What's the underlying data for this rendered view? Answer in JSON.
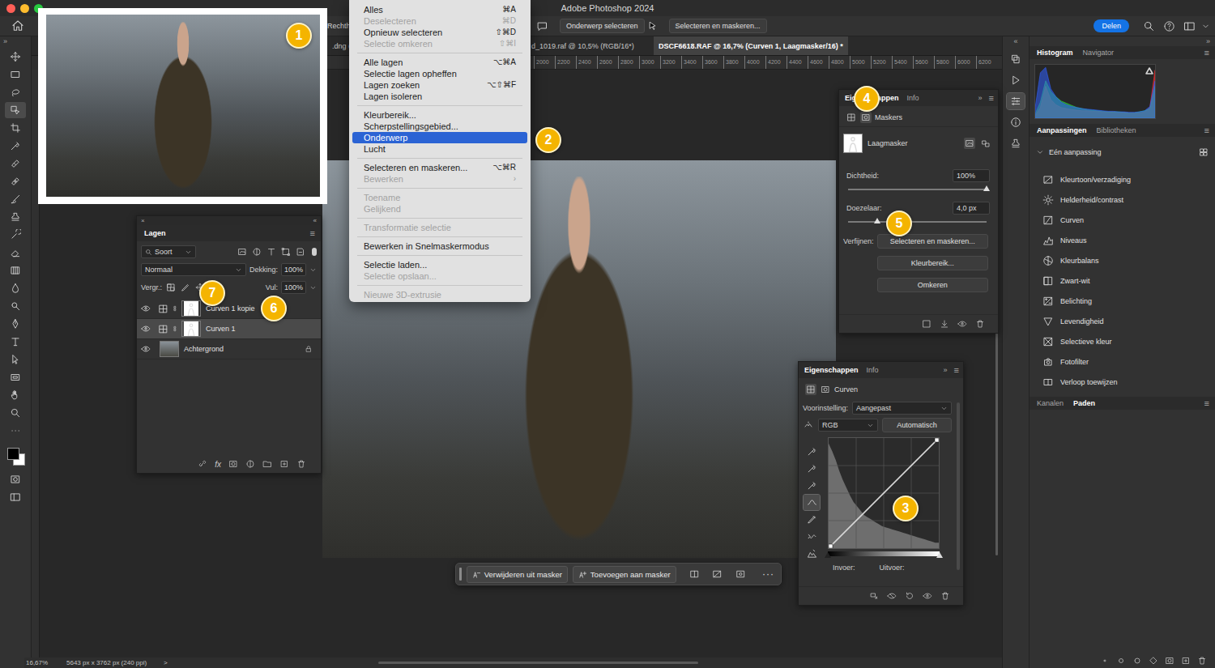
{
  "window": {
    "title": "Adobe Photoshop 2024"
  },
  "options_bar": {
    "tool_label": "Rechth",
    "buttons": [
      "Onderwerp selecteren",
      "Selecteren en maskeren..."
    ],
    "share": "Delen"
  },
  "doc_tabs": [
    {
      "label": ".dng @",
      "selected": false
    },
    {
      "label": "d_1019.raf @ 10,5% (RGB/16*)",
      "selected": false
    },
    {
      "label": "DSCF6618.RAF @ 16,7% (Curven 1, Laagmasker/16) *",
      "selected": true
    }
  ],
  "ruler": [
    "2000",
    "2200",
    "2400",
    "2600",
    "2800",
    "3000",
    "3200",
    "3400",
    "3600",
    "3800",
    "4000",
    "4200",
    "4400",
    "4600",
    "4800",
    "5000",
    "5200",
    "5400",
    "5600",
    "5800",
    "6000",
    "6200"
  ],
  "toolbar": {
    "expand": "»",
    "tools": [
      {
        "selected": false
      },
      {
        "selected": false
      },
      {
        "selected": false
      },
      {
        "selected": true
      },
      {
        "selected": false
      },
      {
        "selected": false
      },
      {
        "selected": false
      },
      {
        "selected": false
      },
      {
        "selected": false
      },
      {
        "selected": false
      },
      {
        "selected": false
      },
      {
        "selected": false
      },
      {
        "selected": false
      },
      {
        "selected": false
      },
      {
        "selected": false
      },
      {
        "selected": false
      },
      {
        "selected": false
      },
      {
        "selected": false
      },
      {
        "selected": false
      },
      {
        "selected": false
      },
      {
        "selected": false
      },
      {
        "selected": false
      }
    ]
  },
  "select_menu": [
    {
      "kind": "item",
      "label": "Alles",
      "shortcut": "⌘A",
      "disabled": false,
      "selected": false
    },
    {
      "kind": "item",
      "label": "Deselecteren",
      "shortcut": "⌘D",
      "disabled": true,
      "selected": false
    },
    {
      "kind": "item",
      "label": "Opnieuw selecteren",
      "shortcut": "⇧⌘D",
      "disabled": false,
      "selected": false
    },
    {
      "kind": "item",
      "label": "Selectie omkeren",
      "shortcut": "⇧⌘I",
      "disabled": true,
      "selected": false
    },
    {
      "kind": "separator",
      "disabled": false,
      "selected": false
    },
    {
      "kind": "item",
      "label": "Alle lagen",
      "shortcut": "⌥⌘A",
      "disabled": false,
      "selected": false
    },
    {
      "kind": "item",
      "label": "Selectie lagen opheffen",
      "shortcut": "",
      "disabled": false,
      "selected": false
    },
    {
      "kind": "item",
      "label": "Lagen zoeken",
      "shortcut": "⌥⇧⌘F",
      "disabled": false,
      "selected": false
    },
    {
      "kind": "item",
      "label": "Lagen isoleren",
      "shortcut": "",
      "disabled": false,
      "selected": false
    },
    {
      "kind": "separator",
      "disabled": false,
      "selected": false
    },
    {
      "kind": "item",
      "label": "Kleurbereik...",
      "shortcut": "",
      "disabled": false,
      "selected": false
    },
    {
      "kind": "item",
      "label": "Scherpstellingsgebied...",
      "shortcut": "",
      "disabled": false,
      "selected": false
    },
    {
      "kind": "item",
      "label": "Onderwerp",
      "shortcut": "",
      "disabled": false,
      "selected": true
    },
    {
      "kind": "item",
      "label": "Lucht",
      "shortcut": "",
      "disabled": false,
      "selected": false
    },
    {
      "kind": "separator",
      "disabled": false,
      "selected": false
    },
    {
      "kind": "item",
      "label": "Selecteren en maskeren...",
      "shortcut": "⌥⌘R",
      "disabled": false,
      "selected": false
    },
    {
      "kind": "item",
      "label": "Bewerken",
      "shortcut": "›",
      "disabled": true,
      "selected": false
    },
    {
      "kind": "separator",
      "disabled": false,
      "selected": false
    },
    {
      "kind": "item",
      "label": "Toename",
      "shortcut": "",
      "disabled": true,
      "selected": false
    },
    {
      "kind": "item",
      "label": "Gelijkend",
      "shortcut": "",
      "disabled": true,
      "selected": false
    },
    {
      "kind": "separator",
      "disabled": false,
      "selected": false
    },
    {
      "kind": "item",
      "label": "Transformatie selectie",
      "shortcut": "",
      "disabled": true,
      "selected": false
    },
    {
      "kind": "separator",
      "disabled": false,
      "selected": false
    },
    {
      "kind": "item",
      "label": "Bewerken in Snelmaskermodus",
      "shortcut": "",
      "disabled": false,
      "selected": false
    },
    {
      "kind": "separator",
      "disabled": false,
      "selected": false
    },
    {
      "kind": "item",
      "label": "Selectie laden...",
      "shortcut": "",
      "disabled": false,
      "selected": false
    },
    {
      "kind": "item",
      "label": "Selectie opslaan...",
      "shortcut": "",
      "disabled": true,
      "selected": false
    },
    {
      "kind": "separator",
      "disabled": false,
      "selected": false
    },
    {
      "kind": "item",
      "label": "Nieuwe 3D-extrusie",
      "shortcut": "",
      "disabled": true,
      "selected": false
    }
  ],
  "layers_panel": {
    "close": "×",
    "collapse": "«",
    "title": "Lagen",
    "menu": "≡",
    "filter": "Soort",
    "blend_mode": "Normaal",
    "opacity_label": "Dekking:",
    "opacity": "100%",
    "lock_label": "Vergr.:",
    "fill_label": "Vul:",
    "fill": "100%",
    "layers": [
      {
        "name": "Curven 1 kopie",
        "kind": "adjustment",
        "visible": true,
        "selected": false,
        "locked": false
      },
      {
        "name": "Curven 1",
        "kind": "adjustment",
        "visible": true,
        "selected": true,
        "locked": false
      },
      {
        "name": "Achtergrond",
        "kind": "image",
        "visible": true,
        "selected": false,
        "locked": true
      }
    ],
    "footer_fx": "fx"
  },
  "mask_properties": {
    "tabs": [
      {
        "label": "Eigenschappen",
        "selected": true
      },
      {
        "label": "Info",
        "selected": false
      }
    ],
    "expand": "»",
    "menu": "≡",
    "section": "Maskers",
    "mask_name": "Laagmasker",
    "sliders": [
      {
        "label": "Dichtheid:",
        "value": "100%",
        "level": 1
      },
      {
        "label": "Doezelaar:",
        "value": "4,0 px",
        "level": 0.21
      }
    ],
    "refine_label": "Verfijnen:",
    "buttons": [
      "Selecteren en maskeren...",
      "Kleurbereik...",
      "Omkeren"
    ]
  },
  "curves_properties": {
    "tabs": [
      {
        "label": "Eigenschappen",
        "selected": true
      },
      {
        "label": "Info",
        "selected": false
      }
    ],
    "expand": "»",
    "menu": "≡",
    "section": "Curven",
    "preset_label": "Voorinstelling:",
    "preset": "Aangepast",
    "channel": "RGB",
    "auto": "Automatisch",
    "input_label": "Invoer:",
    "output_label": "Uitvoer:",
    "tools": [
      {
        "selected": false
      },
      {
        "selected": false
      },
      {
        "selected": false
      },
      {
        "selected": true
      },
      {
        "selected": false
      },
      {
        "selected": false
      },
      {
        "selected": false
      }
    ],
    "histogram": [
      95,
      88,
      80,
      70,
      62,
      55,
      48,
      42,
      38,
      34,
      30,
      28,
      26,
      24,
      22,
      20,
      19,
      18,
      17,
      16,
      15,
      14,
      13,
      12,
      11,
      10,
      9,
      8,
      7,
      6,
      5,
      5
    ],
    "curve": [
      [
        0,
        0
      ],
      [
        255,
        255
      ]
    ]
  },
  "icon_strip": {
    "collapse": "«",
    "items": [
      {
        "selected": false
      },
      {
        "selected": false
      },
      {
        "selected": true
      },
      {
        "selected": false
      },
      {
        "selected": false
      }
    ]
  },
  "dock": {
    "expand": "»",
    "top_tabs": [
      {
        "label": "Histogram",
        "selected": true
      },
      {
        "label": "Navigator",
        "selected": false
      }
    ],
    "menu": "≡",
    "histogram": [
      {
        "color": "#ff3030",
        "values": [
          5,
          20,
          60,
          35,
          25,
          20,
          18,
          16,
          15,
          14,
          14,
          13,
          13,
          12,
          12,
          12,
          11,
          11,
          10,
          10,
          10,
          12,
          20,
          90
        ]
      },
      {
        "color": "#30e040",
        "values": [
          8,
          30,
          70,
          50,
          40,
          32,
          28,
          24,
          20,
          18,
          16,
          15,
          14,
          13,
          12,
          12,
          12,
          11,
          10,
          10,
          12,
          14,
          18,
          60
        ]
      },
      {
        "color": "#3060ff",
        "values": [
          20,
          85,
          95,
          55,
          40,
          30,
          25,
          22,
          20,
          18,
          17,
          16,
          15,
          14,
          13,
          13,
          12,
          12,
          11,
          11,
          12,
          14,
          22,
          70
        ]
      }
    ],
    "adj_tabs": [
      {
        "label": "Aanpassingen",
        "selected": true
      },
      {
        "label": "Bibliotheken",
        "selected": false
      }
    ],
    "group": {
      "label": "Eén aanpassing",
      "expanded": true
    },
    "adjustments": [
      "Kleurtoon/verzadiging",
      "Helderheid/contrast",
      "Curven",
      "Niveaus",
      "Kleurbalans",
      "Zwart-wit",
      "Belichting",
      "Levendigheid",
      "Selectieve kleur",
      "Fotofilter",
      "Verloop toewijzen"
    ],
    "bottom_tabs": [
      {
        "label": "Kanalen",
        "selected": false
      },
      {
        "label": "Paden",
        "selected": true
      }
    ]
  },
  "taskbar": {
    "buttons": [
      "Verwijderen uit masker",
      "Toevoegen aan masker"
    ],
    "more": "···"
  },
  "status_bar": {
    "zoom": "16,67%",
    "size": "5643 px x 3762 px (240 ppi)",
    "arrow": ">"
  },
  "badges": [
    "1",
    "2",
    "3",
    "4",
    "5",
    "6",
    "7"
  ]
}
